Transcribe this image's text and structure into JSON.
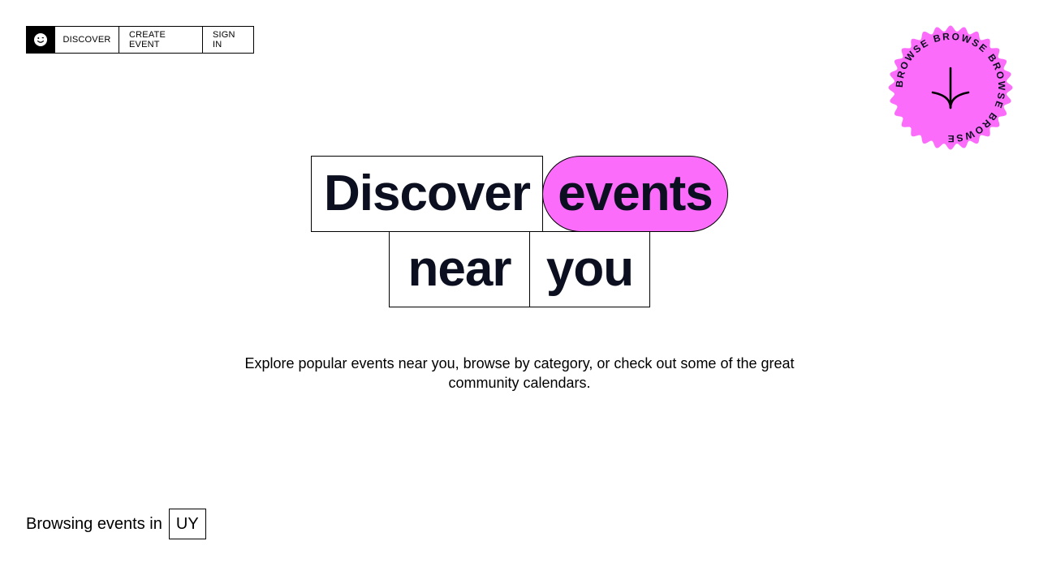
{
  "nav": {
    "logo_icon": "smiley-icon",
    "items": [
      "DISCOVER",
      "CREATE EVENT",
      "SIGN IN"
    ]
  },
  "badge": {
    "ring_text": "BROWSE BROWSE BROWSE BROWSE",
    "icon": "arrow-down-icon",
    "color": "#fc6cfb"
  },
  "headline": {
    "words": [
      "Discover",
      "events",
      "near",
      "you"
    ],
    "accent_color": "#fc6cfb"
  },
  "description": "Explore popular events near you, browse by category, or check out some of the great community calendars.",
  "location": {
    "label": "Browsing events in",
    "country": "UY"
  }
}
